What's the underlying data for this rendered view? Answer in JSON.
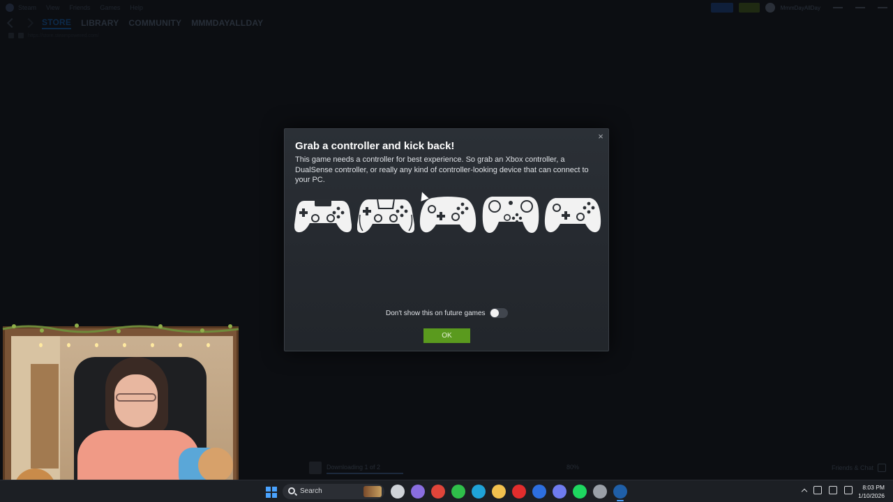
{
  "steam": {
    "menu": [
      "Steam",
      "View",
      "Friends",
      "Games",
      "Help"
    ],
    "nav_tabs": [
      "STORE",
      "LIBRARY",
      "COMMUNITY",
      "MMMDAYALLDAY"
    ],
    "account_name": "MmmDayAllDay",
    "url": "https://store.steampowered.com/",
    "download_status": "Downloading 1 of 2",
    "download_percent": "80%",
    "friends_chat": "Friends & Chat"
  },
  "dialog": {
    "title": "Grab a controller and kick back!",
    "body": "This game needs a controller for best experience. So grab an Xbox controller, a DualSense controller, or really any kind of controller-looking device that can connect to your PC.",
    "controllers": [
      "playstation-4-controller-icon",
      "dualsense-controller-icon",
      "xbox-controller-icon",
      "steam-controller-icon",
      "switch-pro-controller-icon"
    ],
    "toggle_label": "Don't show this on future games",
    "toggle_on": false,
    "ok_label": "OK",
    "close_label": "×",
    "accent": "#5a9a1e"
  },
  "taskbar": {
    "search_label": "Search",
    "apps": [
      {
        "name": "file-explorer-task-view-icon",
        "color": "#cfd3d8"
      },
      {
        "name": "copilot-icon",
        "color": "#8a6ee0"
      },
      {
        "name": "chrome-icon",
        "color": "#e0453a"
      },
      {
        "name": "xbox-app-icon",
        "color": "#2fbf4a"
      },
      {
        "name": "edge-icon",
        "color": "#1fa3d8"
      },
      {
        "name": "file-folder-icon",
        "color": "#f2c14e"
      },
      {
        "name": "youtube-icon",
        "color": "#e22d2d"
      },
      {
        "name": "facebook-icon",
        "color": "#2d6fe0"
      },
      {
        "name": "discord-icon",
        "color": "#6f7cf0"
      },
      {
        "name": "spotify-icon",
        "color": "#1ed760"
      },
      {
        "name": "obs-icon",
        "color": "#9aa0a8"
      },
      {
        "name": "steam-icon",
        "color": "#1f5fa8",
        "active": true
      }
    ],
    "time": "8:03 PM",
    "date": "1/10/2026"
  }
}
